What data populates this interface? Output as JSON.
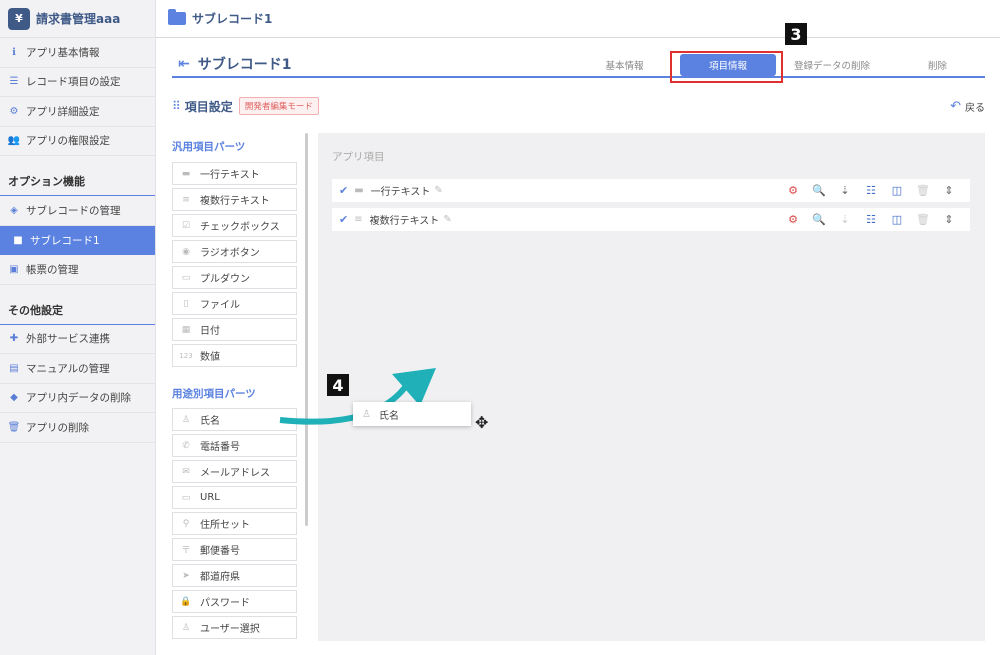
{
  "app": {
    "logo_char": "¥",
    "title": "請求書管理aaa"
  },
  "sidebar": {
    "items": [
      {
        "label": "アプリ基本情報",
        "icon": "info-icon"
      },
      {
        "label": "レコード項目の設定",
        "icon": "list-icon"
      },
      {
        "label": "アプリ詳細設定",
        "icon": "gear-icon"
      },
      {
        "label": "アプリの権限設定",
        "icon": "users-icon"
      }
    ],
    "option_title": "オプション機能",
    "option_items": [
      {
        "label": "サブレコードの管理",
        "icon": "layers-icon"
      },
      {
        "label": "サブレコード1",
        "icon": "folder-icon",
        "active": true
      },
      {
        "label": "帳票の管理",
        "icon": "excel-icon"
      }
    ],
    "other_title": "その他設定",
    "other_items": [
      {
        "label": "外部サービス連携",
        "icon": "puzzle-icon"
      },
      {
        "label": "マニュアルの管理",
        "icon": "book-icon"
      },
      {
        "label": "アプリ内データの削除",
        "icon": "eraser-icon"
      },
      {
        "label": "アプリの削除",
        "icon": "trash-icon"
      }
    ]
  },
  "topbar": {
    "title": "サブレコード1"
  },
  "page": {
    "title": "サブレコード1",
    "tabs": [
      "基本情報",
      "項目情報",
      "登録データの削除",
      "削除"
    ],
    "active_tab": "項目情報"
  },
  "section": {
    "title": "項目設定",
    "badge": "開発者編集モード",
    "back_label": "戻る"
  },
  "palette": {
    "general_title": "汎用項目パーツ",
    "general_parts": [
      {
        "label": "一行テキスト",
        "icon": "line-icon"
      },
      {
        "label": "複数行テキスト",
        "icon": "lines-icon"
      },
      {
        "label": "チェックボックス",
        "icon": "checkbox-icon"
      },
      {
        "label": "ラジオボタン",
        "icon": "radio-icon"
      },
      {
        "label": "プルダウン",
        "icon": "dropdown-icon"
      },
      {
        "label": "ファイル",
        "icon": "file-icon"
      },
      {
        "label": "日付",
        "icon": "calendar-icon"
      },
      {
        "label": "数値",
        "icon": "number-icon"
      }
    ],
    "purpose_title": "用途別項目パーツ",
    "purpose_parts": [
      {
        "label": "氏名",
        "icon": "person-icon"
      },
      {
        "label": "電話番号",
        "icon": "phone-icon"
      },
      {
        "label": "メールアドレス",
        "icon": "mail-icon"
      },
      {
        "label": "URL",
        "icon": "url-icon"
      },
      {
        "label": "住所セット",
        "icon": "pin-icon"
      },
      {
        "label": "郵便番号",
        "icon": "postal-icon"
      },
      {
        "label": "都道府県",
        "icon": "map-icon"
      },
      {
        "label": "パスワード",
        "icon": "lock-icon"
      },
      {
        "label": "ユーザー選択",
        "icon": "user-icon"
      }
    ]
  },
  "canvas": {
    "label": "アプリ項目",
    "fields": [
      {
        "label": "一行テキスト",
        "icon": "line-icon"
      },
      {
        "label": "複数行テキスト",
        "icon": "lines-icon"
      }
    ]
  },
  "drag": {
    "label": "氏名"
  },
  "steps": {
    "three": "3",
    "four": "4"
  },
  "colors": {
    "accent": "#5b82e0",
    "highlight": "#e03030",
    "arrow": "#1fb0b8",
    "gear": "#d94a4a"
  }
}
